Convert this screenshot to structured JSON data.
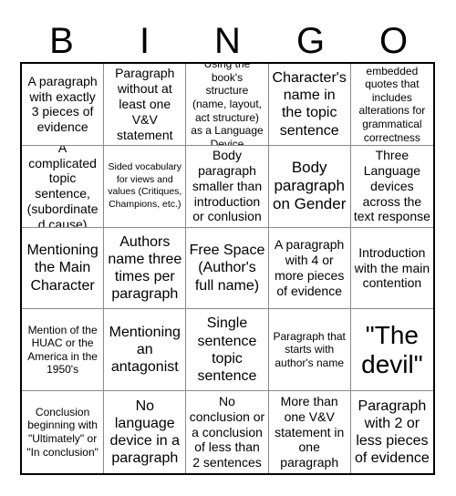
{
  "card": {
    "header_letters": [
      "B",
      "I",
      "N",
      "G",
      "O"
    ],
    "colors": {
      "background": "#ffffff",
      "text": "#000000",
      "outer_border": "#000000",
      "cell_border": "#8a8a8a"
    },
    "rows": [
      [
        {
          "text": "A paragraph with exactly 3 pieces of evidence",
          "size": "m"
        },
        {
          "text": "Paragraph without at least one V&V statement",
          "size": "m"
        },
        {
          "text": "Using the book's structure (name, layout, act structure) as a Language Device",
          "size": "s"
        },
        {
          "text": "Character's name in the topic sentence",
          "size": "l"
        },
        {
          "text": "embedded quotes that includes alterations for grammatical correctness",
          "size": "s"
        }
      ],
      [
        {
          "text": "A complicated topic sentence, (subordinated cause)",
          "size": "m"
        },
        {
          "text": "Sided vocabulary for views and values (Critiques, Champions, etc.)",
          "size": "xs"
        },
        {
          "text": "Body paragraph smaller than introduction or conlusion",
          "size": "m"
        },
        {
          "text": "Body paragraph on Gender",
          "size": "xl"
        },
        {
          "text": "Three Language devices across the text response",
          "size": "m"
        }
      ],
      [
        {
          "text": "Mentioning the Main Character",
          "size": "l"
        },
        {
          "text": "Authors name three times per paragraph",
          "size": "l"
        },
        {
          "text": "Free Space (Author's full name)",
          "size": "l"
        },
        {
          "text": "A paragraph with 4 or more pieces of evidence",
          "size": "m"
        },
        {
          "text": "Introduction with the main contention",
          "size": "m"
        }
      ],
      [
        {
          "text": "Mention of the HUAC or the America in the 1950's",
          "size": "s"
        },
        {
          "text": "Mentioning an antagonist",
          "size": "l"
        },
        {
          "text": "Single sentence topic sentence",
          "size": "l"
        },
        {
          "text": "Paragraph that starts with author's name",
          "size": "s"
        },
        {
          "text": "\"The devil\"",
          "size": "xxl"
        }
      ],
      [
        {
          "text": "Conclusion beginning with \"Ultimately\" or \"In conclusion\"",
          "size": "s"
        },
        {
          "text": "No language device in a paragraph",
          "size": "l"
        },
        {
          "text": "No conclusion or a conclusion of less than 2 sentences",
          "size": "m"
        },
        {
          "text": "More than one V&V statement in one paragraph",
          "size": "m"
        },
        {
          "text": "Paragraph with 2 or less pieces of evidence",
          "size": "l"
        }
      ]
    ]
  }
}
